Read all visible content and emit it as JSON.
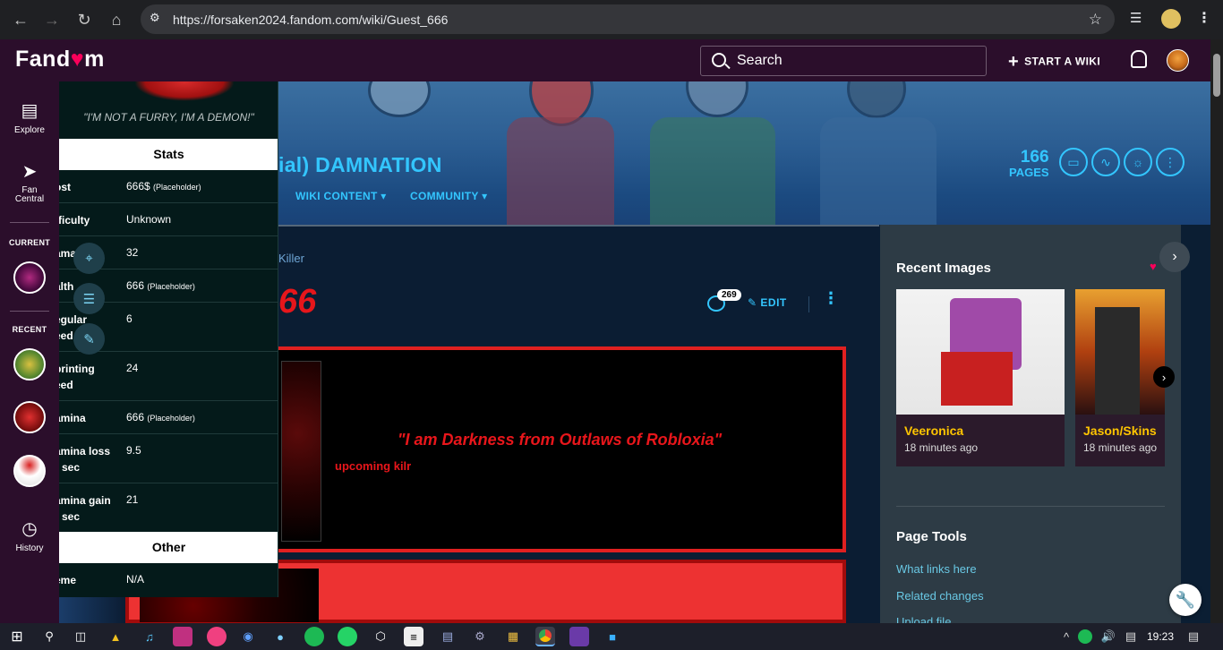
{
  "browser": {
    "url": "https://forsaken2024.fandom.com/wiki/Guest_666"
  },
  "fandom": {
    "logo": "Fandom",
    "search_label": "Search",
    "start_wiki": "START A WIKI"
  },
  "rail": {
    "explore": "Explore",
    "fan_central": "Fan Central",
    "current": "CURRENT",
    "recent": "RECENT",
    "history": "History"
  },
  "community": {
    "title_fragment": "ial) DAMNATION",
    "nav": [
      "WIKI CONTENT",
      "COMMUNITY"
    ],
    "page_count": "166",
    "page_count_label": "PAGES"
  },
  "article": {
    "breadcrumb": "Killer",
    "title_fragment": "66",
    "comment_count": "269",
    "edit_label": "EDIT",
    "quote": "\"I am Darkness from Outlaws of Robloxia\"",
    "note": "upcoming kilr"
  },
  "infobox": {
    "caption": "\"I'M NOT A FURRY, I'M A DEMON!\"",
    "stats_header": "Stats",
    "other_header": "Other",
    "rows": [
      {
        "key1": "ost",
        "key2": "",
        "value": "666$",
        "note": "(Placeholder)"
      },
      {
        "key1": "fficulty",
        "key2": "",
        "value": "Unknown",
        "note": ""
      },
      {
        "key1": "ama",
        "key2": "",
        "value": "32",
        "note": ""
      },
      {
        "key1": "alth",
        "key2": "",
        "value": "666",
        "note": "(Placeholder)"
      },
      {
        "key1": "egular",
        "key2": "eed",
        "value": "6",
        "note": ""
      },
      {
        "key1": "printing",
        "key2": "eed",
        "value": "24",
        "note": ""
      },
      {
        "key1": "amina",
        "key2": "",
        "value": "666",
        "note": "(Placeholder)"
      },
      {
        "key1": "amina loss",
        "key2": "r sec",
        "value": "9.5",
        "note": ""
      },
      {
        "key1": "amina gain",
        "key2": "r sec",
        "value": "21",
        "note": ""
      }
    ],
    "theme_key": "eme",
    "theme_value": "N/A"
  },
  "right_rail": {
    "recent_images": "Recent Images",
    "cards": [
      {
        "name": "Veeronica",
        "time": "18 minutes ago"
      },
      {
        "name": "Jason/Skins",
        "time": "18 minutes ago"
      }
    ],
    "page_tools": "Page Tools",
    "tools": [
      "What links here",
      "Related changes",
      "Upload file"
    ]
  },
  "taskbar": {
    "time": "19:23"
  }
}
